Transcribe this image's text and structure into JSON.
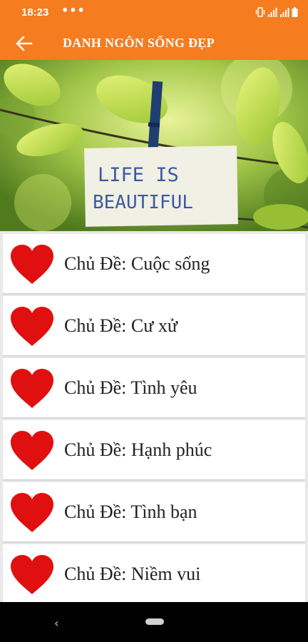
{
  "status_bar": {
    "time": "18:23",
    "dots": "•••",
    "icons": [
      "vibrate-icon",
      "signal-icon",
      "signal-icon",
      "battery-icon"
    ]
  },
  "app_bar": {
    "title": "DANH NGÔN SỐNG ĐẸP",
    "back_icon": "arrow-left-icon"
  },
  "banner": {
    "note_line1": "LIFE IS",
    "note_line2": "BEAUTIFUL"
  },
  "topics": [
    {
      "label": "Chủ Đề: Cuộc sống",
      "icon": "heart-icon"
    },
    {
      "label": "Chủ Đề: Cư xử",
      "icon": "heart-icon"
    },
    {
      "label": "Chủ Đề: Tình yêu",
      "icon": "heart-icon"
    },
    {
      "label": "Chủ Đề: Hạnh phúc",
      "icon": "heart-icon"
    },
    {
      "label": "Chủ Đề: Tình bạn",
      "icon": "heart-icon"
    },
    {
      "label": "Chủ Đề: Niềm vui",
      "icon": "heart-icon"
    }
  ],
  "nav_bar": {
    "back_glyph": "‹"
  },
  "colors": {
    "accent": "#f57c1f",
    "heart": "#e01010",
    "background": "#e9e9e9"
  }
}
